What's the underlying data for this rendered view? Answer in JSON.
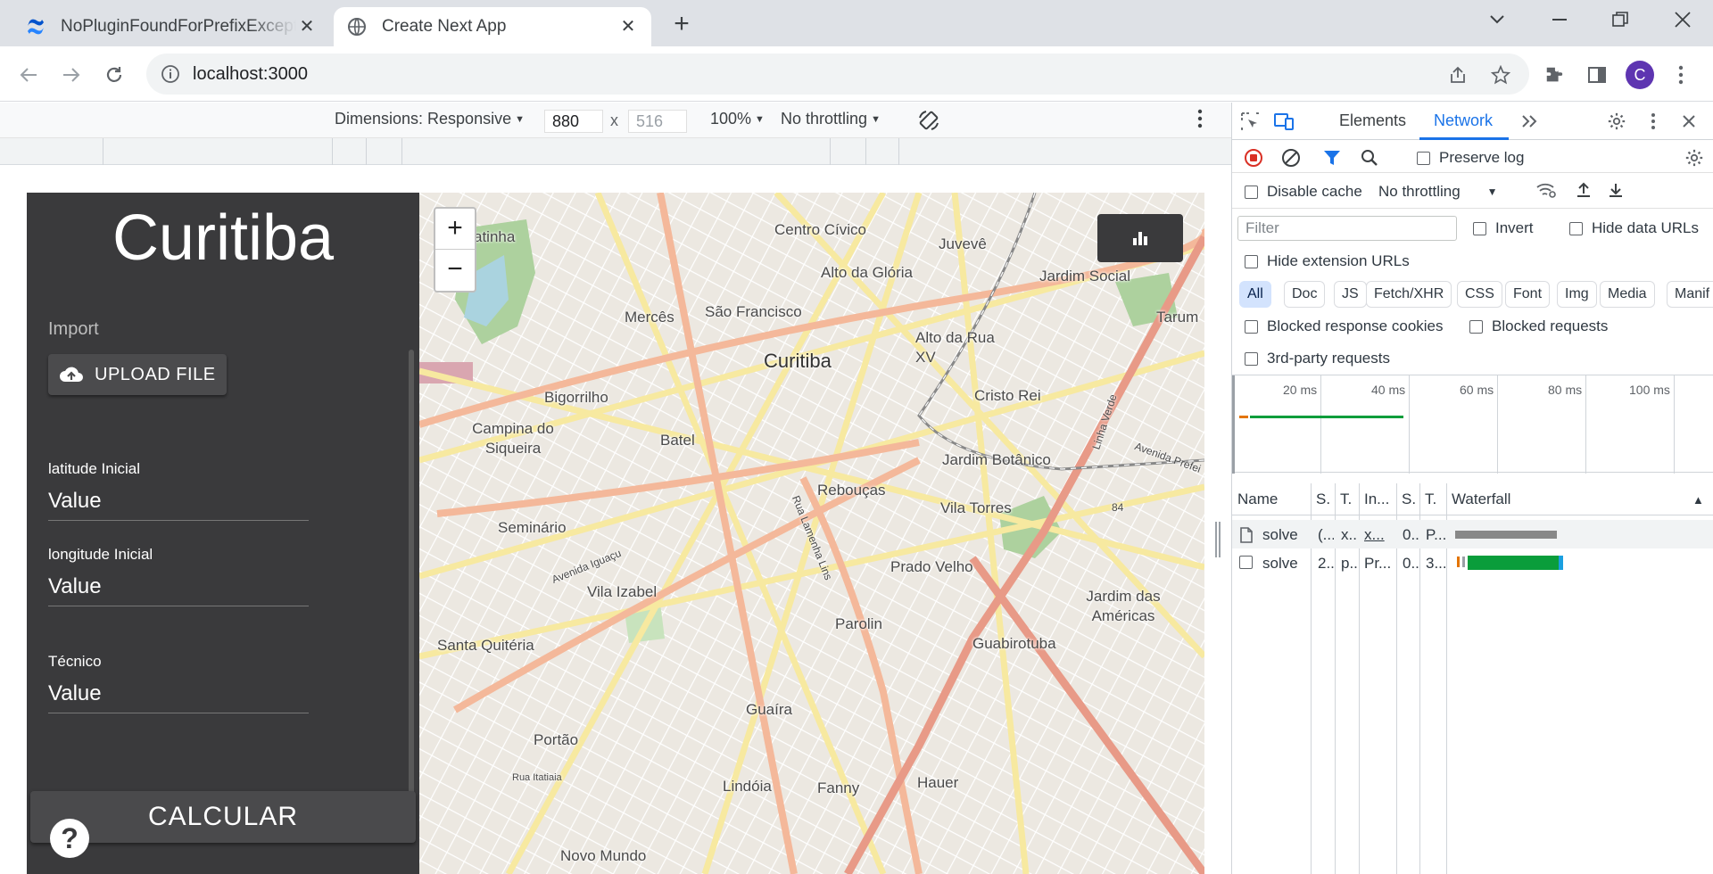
{
  "browser": {
    "tabs": [
      {
        "title": "NoPluginFoundForPrefixException",
        "active": false
      },
      {
        "title": "Create Next App",
        "active": true
      }
    ],
    "url": "localhost:3000",
    "profile_initial": "C"
  },
  "device_toolbar": {
    "dimensions_label": "Dimensions: Responsive",
    "width": "880",
    "height": "516",
    "times": "x",
    "zoom": "100%",
    "throttle": "No throttling"
  },
  "app": {
    "city": "Curitiba",
    "import_label": "Import",
    "upload_label": "UPLOAD FILE",
    "fields": [
      {
        "label": "latitude Inicial",
        "value": "Value"
      },
      {
        "label": "longitude Inicial",
        "value": "Value"
      },
      {
        "label": "Técnico",
        "value": "Value"
      }
    ],
    "calc_label": "CALCULAR",
    "help_label": "?"
  },
  "map": {
    "zoom_in": "+",
    "zoom_out": "−",
    "labels": [
      {
        "text": "Centro Cívico"
      },
      {
        "text": "Juvevê"
      },
      {
        "text": "Alto da Glória"
      },
      {
        "text": "Jardim Social"
      },
      {
        "text": "Mercês"
      },
      {
        "text": "São Francisco"
      },
      {
        "text": "Alto da Rua XV"
      },
      {
        "text": "Tarum"
      },
      {
        "text": "Curitiba"
      },
      {
        "text": "Cristo Rei"
      },
      {
        "text": "Bigorrilho"
      },
      {
        "text": "Campina do Siqueira"
      },
      {
        "text": "Batel"
      },
      {
        "text": "Jardim Botânico"
      },
      {
        "text": "Rebouças"
      },
      {
        "text": "Vila Torres"
      },
      {
        "text": "Seminário"
      },
      {
        "text": "Prado Velho"
      },
      {
        "text": "Vila Izabel"
      },
      {
        "text": "Jardim das Américas"
      },
      {
        "text": "Parolin"
      },
      {
        "text": "Santa Quitéria"
      },
      {
        "text": "Guabirotuba"
      },
      {
        "text": "Guaíra"
      },
      {
        "text": "Portão"
      },
      {
        "text": "Lindóia"
      },
      {
        "text": "Fanny"
      },
      {
        "text": "Hauer"
      },
      {
        "text": "Novo Mundo"
      },
      {
        "text": "scatinha"
      },
      {
        "text": "Avenida Iguaçu"
      },
      {
        "text": "Rua Lamenha Lins"
      },
      {
        "text": "Rua Itatiaia"
      },
      {
        "text": "Avenida Prefei"
      },
      {
        "text": "Linha Verde"
      },
      {
        "text": "84"
      }
    ]
  },
  "devtools": {
    "tabs": [
      "Elements",
      "Network"
    ],
    "active_tab": "Network",
    "preserve_log": "Preserve log",
    "disable_cache": "Disable cache",
    "throttling": "No throttling",
    "filter_placeholder": "Filter",
    "invert": "Invert",
    "hide_data_urls": "Hide data URLs",
    "hide_extension_urls": "Hide extension URLs",
    "type_filters": [
      "All",
      "Doc",
      "JS",
      "Fetch/XHR",
      "CSS",
      "Font",
      "Img",
      "Media",
      "Manif"
    ],
    "blocked_cookies": "Blocked response cookies",
    "blocked_requests": "Blocked requests",
    "third_party": "3rd-party requests",
    "timeline_ticks": [
      "20 ms",
      "40 ms",
      "60 ms",
      "80 ms",
      "100 ms"
    ],
    "columns": [
      "Name",
      "S.",
      "T.",
      "In...",
      "S.",
      "T.",
      "Waterfall"
    ],
    "rows": [
      {
        "name": "solve",
        "status": "(...",
        "type": "x...",
        "initiator": "x...",
        "size": "0...",
        "time": "P..."
      },
      {
        "name": "solve",
        "status": "2...",
        "type": "p...",
        "initiator": "Pr...",
        "size": "0...",
        "time": "3..."
      }
    ]
  },
  "colors": {
    "sidebar_bg": "#3a3a3c",
    "devtools_accent": "#1a73e8",
    "waterfall_green": "#0a9d3b",
    "record_red": "#d93025"
  }
}
